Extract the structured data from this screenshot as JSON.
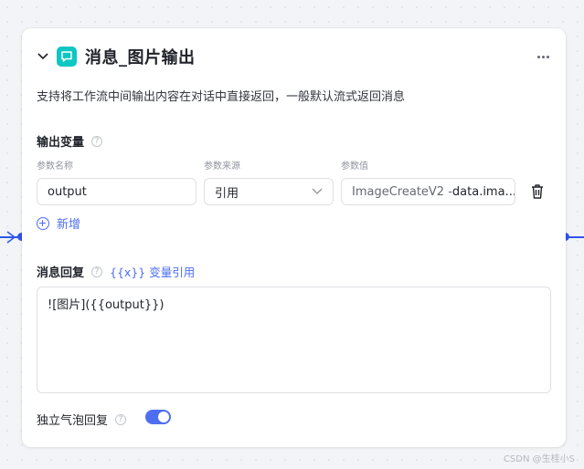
{
  "node": {
    "title": "消息_图片输出",
    "description": "支持将工作流中间输出内容在对话中直接返回，一般默认流式返回消息",
    "icon": "chat-bubble-icon",
    "icon_color": "#0fc6c2"
  },
  "output_vars": {
    "label": "输出变量",
    "columns": {
      "name": "参数名称",
      "source": "参数来源",
      "value": "参数值"
    },
    "row": {
      "name": "output",
      "source": "引用",
      "value_prefix": "ImageCreateV2 - ",
      "value_rest": "data.ima..."
    },
    "add_label": "新增"
  },
  "message_reply": {
    "label": "消息回复",
    "var_ref_label": "{{x}} 变量引用",
    "content": "![图片]({{output}})"
  },
  "bubble_reply": {
    "label": "独立气泡回复",
    "enabled": true
  },
  "watermark": "CSDN @生桂小S",
  "colors": {
    "accent": "#4e6ef2",
    "edge": "#2f54eb"
  }
}
